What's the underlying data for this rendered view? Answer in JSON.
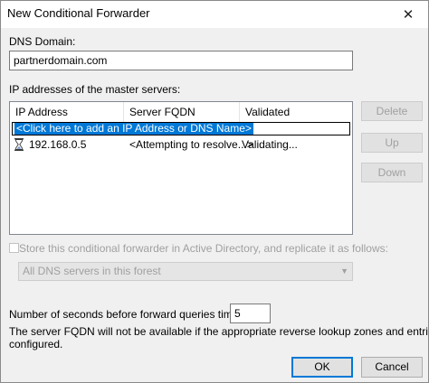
{
  "window": {
    "title": "New Conditional Forwarder",
    "close_glyph": "✕"
  },
  "dns_domain": {
    "label": "DNS Domain:",
    "value": "partnerdomain.com"
  },
  "master_servers": {
    "label": "IP addresses of the master servers:",
    "columns": [
      "IP Address",
      "Server FQDN",
      "Validated"
    ],
    "add_prompt": "<Click here to add an IP Address or DNS Name>",
    "rows": [
      {
        "icon": "hourglass-icon",
        "ip": "192.168.0.5",
        "fqdn": "<Attempting to resolve...>",
        "validated": "Validating..."
      }
    ]
  },
  "side_buttons": {
    "delete": "Delete",
    "up": "Up",
    "down": "Down"
  },
  "replicate": {
    "label": "Store this conditional forwarder in Active Directory, and replicate it as follows:",
    "checked": false,
    "scope_selected": "All DNS servers in this forest"
  },
  "timeout": {
    "label": "Number of seconds before forward queries time out:",
    "value": "5"
  },
  "note": {
    "line1": "The server FQDN will not be available if the appropriate reverse lookup zones and entries are not",
    "line2": "configured."
  },
  "buttons": {
    "ok": "OK",
    "cancel": "Cancel"
  }
}
